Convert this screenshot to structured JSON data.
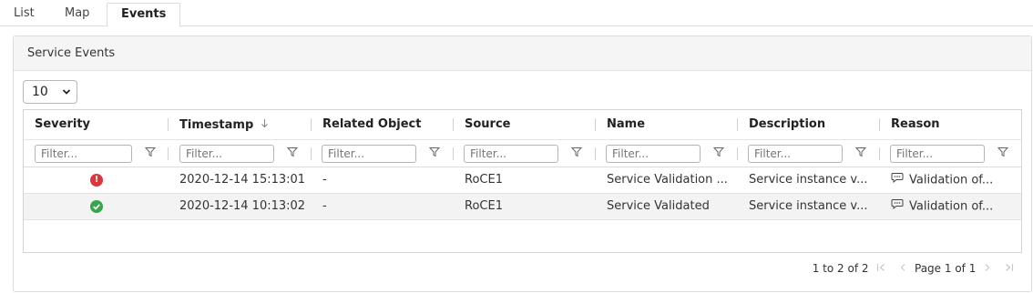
{
  "tabs": [
    {
      "label": "List"
    },
    {
      "label": "Map"
    },
    {
      "label": "Events",
      "active": true
    }
  ],
  "panel": {
    "title": "Service Events"
  },
  "page_size": {
    "value": "10"
  },
  "columns": [
    {
      "label": "Severity"
    },
    {
      "label": "Timestamp"
    },
    {
      "label": "Related Object"
    },
    {
      "label": "Source"
    },
    {
      "label": "Name"
    },
    {
      "label": "Description"
    },
    {
      "label": "Reason"
    }
  ],
  "filter_placeholder": "Filter...",
  "rows": [
    {
      "severity": "error",
      "timestamp": "2020-12-14 15:13:01",
      "related_object": "-",
      "source": "RoCE1",
      "name": "Service Validation ...",
      "description": "Service instance v...",
      "reason": "Validation of..."
    },
    {
      "severity": "ok",
      "timestamp": "2020-12-14 10:13:02",
      "related_object": "-",
      "source": "RoCE1",
      "name": "Service Validated",
      "description": "Service instance v...",
      "reason": "Validation of..."
    }
  ],
  "pager": {
    "summary": "1 to 2 of 2",
    "page_text": "Page 1 of 1"
  },
  "colors": {
    "error": "#d9363e",
    "ok": "#35a64a"
  }
}
